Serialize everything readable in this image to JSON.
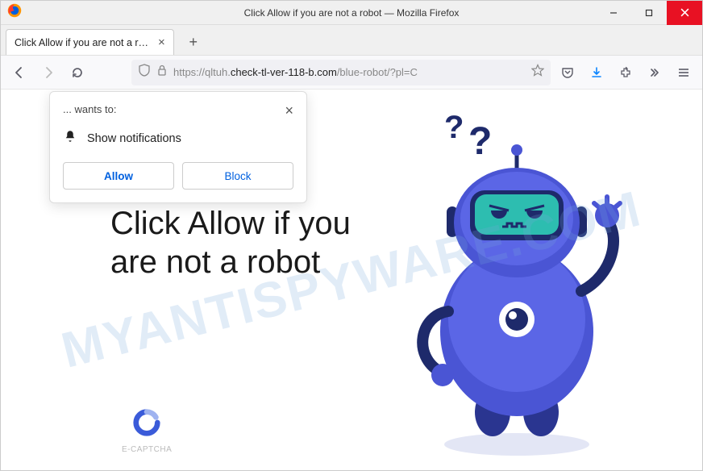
{
  "window": {
    "title": "Click Allow if you are not a robot — Mozilla Firefox"
  },
  "tab": {
    "label": "Click Allow if you are not a robot"
  },
  "url": {
    "scheme": "https://",
    "sub": "qltuh.",
    "host": "check-tl-ver-118-b.com",
    "path": "/blue-robot/?pl=C"
  },
  "permission": {
    "origin_line": "... wants to:",
    "request": "Show notifications",
    "allow": "Allow",
    "block": "Block"
  },
  "page": {
    "headline": "Click Allow if you are not a robot",
    "captcha_label": "E-CAPTCHA"
  },
  "watermark": "MYANTISPYWARE.COM"
}
